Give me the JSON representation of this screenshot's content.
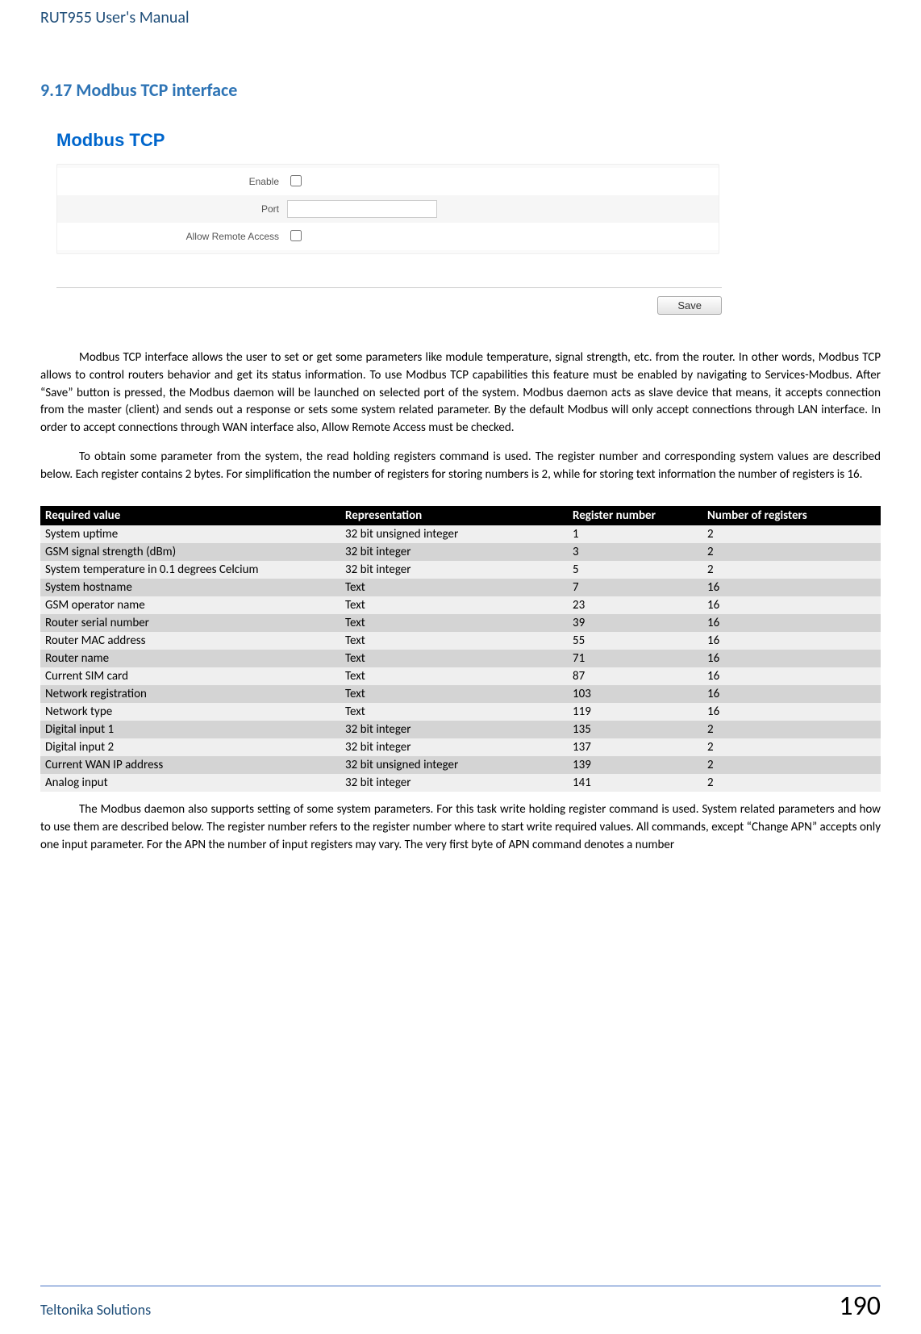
{
  "header": {
    "doc_title": "RUT955 User's Manual"
  },
  "section": {
    "heading": "9.17 Modbus TCP interface"
  },
  "screenshot": {
    "panel_title": "Modbus TCP",
    "rows": {
      "enable": {
        "label": "Enable"
      },
      "port": {
        "label": "Port",
        "value": ""
      },
      "allow_remote": {
        "label": "Allow Remote Access"
      }
    },
    "save_button": "Save"
  },
  "paragraphs": {
    "p1": "Modbus TCP interface allows the user to set or get some parameters like module temperature, signal strength, etc. from the router. In other words, Modbus TCP allows to control routers behavior and get its status information. To use Modbus TCP capabilities this feature must be enabled by navigating to Services-Modbus. After “Save” button is pressed, the Modbus daemon will be launched on selected port of the system. Modbus daemon acts as slave device that means, it accepts connection from the master (client) and sends out a response or sets some system related parameter. By the default Modbus will only accept connections through LAN interface. In order to accept connections through WAN interface also, Allow Remote Access must be checked.",
    "p2": "To obtain some parameter from the system, the read holding registers command is used. The register number and corresponding system values are described below. Each register contains 2 bytes. For simplification the number of registers for storing numbers is 2, while for storing  text information the number of registers is 16.",
    "p3": "The Modbus daemon also supports setting of some system parameters. For this task write holding register command is used. System related parameters and how to use them are described below. The register number refers to the register number where to start write required values. All commands, except “Change APN” accepts only one input parameter. For the APN the number of input registers may vary. The very first byte of APN command denotes a number"
  },
  "table": {
    "headers": [
      "Required value",
      "Representation",
      "Register number",
      "Number of registers"
    ],
    "rows": [
      [
        "System uptime",
        "32 bit unsigned integer",
        "1",
        "2"
      ],
      [
        "GSM signal strength (dBm)",
        "32 bit integer",
        "3",
        "2"
      ],
      [
        "System temperature in 0.1 degrees Celcium",
        "32 bit integer",
        "5",
        "2"
      ],
      [
        "System hostname",
        "Text",
        "7",
        "16"
      ],
      [
        "GSM operator name",
        "Text",
        "23",
        "16"
      ],
      [
        "Router serial number",
        "Text",
        "39",
        "16"
      ],
      [
        "Router MAC address",
        "Text",
        "55",
        "16"
      ],
      [
        "Router name",
        "Text",
        "71",
        "16"
      ],
      [
        "Current SIM card",
        "Text",
        "87",
        "16"
      ],
      [
        "Network registration",
        "Text",
        "103",
        "16"
      ],
      [
        "Network type",
        "Text",
        "119",
        "16"
      ],
      [
        "Digital input 1",
        "32 bit integer",
        "135",
        "2"
      ],
      [
        "Digital input 2",
        "32 bit integer",
        "137",
        "2"
      ],
      [
        "Current WAN IP address",
        "32 bit unsigned integer",
        "139",
        "2"
      ],
      [
        "Analog input",
        "32 bit integer",
        "141",
        "2"
      ]
    ]
  },
  "footer": {
    "left": "Teltonika Solutions",
    "right": "190"
  }
}
